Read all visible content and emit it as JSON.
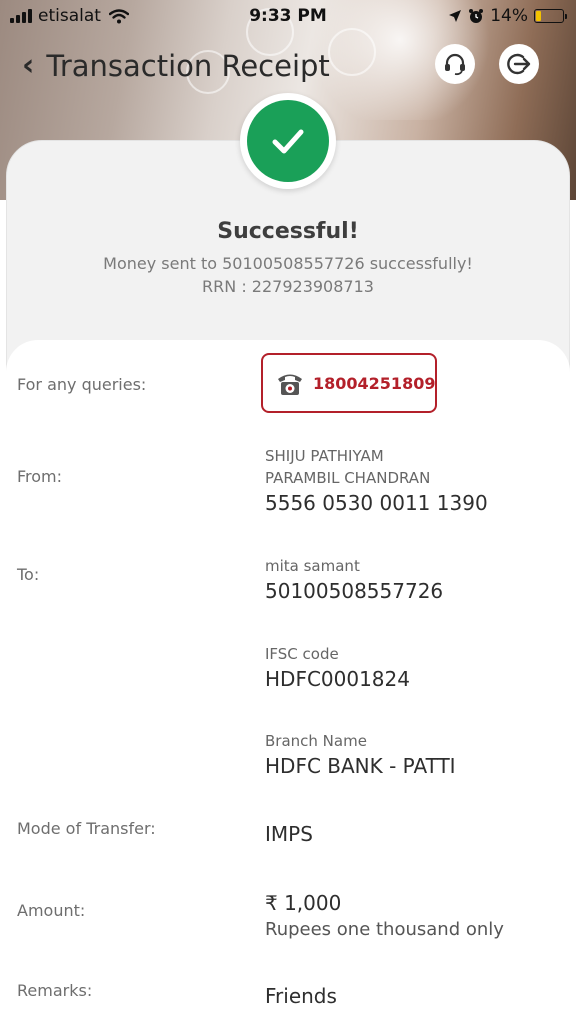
{
  "status_bar": {
    "carrier": "etisalat",
    "time": "9:33 PM",
    "battery": "14%"
  },
  "header": {
    "title": "Transaction Receipt"
  },
  "result": {
    "title": "Successful!",
    "message": "Money sent to 50100508557726 successfully!",
    "rrn": "RRN : 227923908713"
  },
  "details": {
    "queries_label": "For any queries:",
    "queries_phone": "18004251809",
    "from_label": "From:",
    "from_name_line1": "SHIJU PATHIYAM",
    "from_name_line2": "PARAMBIL CHANDRAN",
    "from_account": "5556 0530 0011 1390",
    "to_label": "To:",
    "to_name": "mita samant",
    "to_account": "50100508557726",
    "ifsc_label": "IFSC code",
    "ifsc_value": "HDFC0001824",
    "branch_label": "Branch Name",
    "branch_value": "HDFC BANK - PATTI",
    "mode_label": "Mode of Transfer:",
    "mode_value": "IMPS",
    "amount_label": "Amount:",
    "amount_value": "₹ 1,000",
    "amount_words": "Rupees one thousand only",
    "remarks_label": "Remarks:",
    "remarks_value": "Friends"
  },
  "colors": {
    "success_green": "#1aa058",
    "accent_red": "#b3202a"
  },
  "icons": [
    "back-chevron-icon",
    "headset-icon",
    "logout-icon",
    "checkmark-icon",
    "telephone-icon",
    "wifi-icon",
    "location-icon",
    "alarm-icon"
  ]
}
